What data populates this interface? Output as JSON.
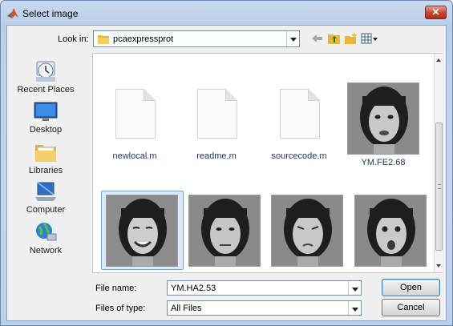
{
  "window": {
    "title": "Select image",
    "close_glyph": "✕"
  },
  "toolbar": {
    "look_in_label": "Look in:",
    "look_in_value": "pcaexpressprot",
    "icons": [
      "back-arrow-icon",
      "up-folder-icon",
      "new-folder-icon",
      "view-menu-icon"
    ]
  },
  "places": [
    {
      "label": "Recent Places",
      "icon": "recent-places-icon"
    },
    {
      "label": "Desktop",
      "icon": "desktop-icon"
    },
    {
      "label": "Libraries",
      "icon": "libraries-icon"
    },
    {
      "label": "Computer",
      "icon": "computer-icon"
    },
    {
      "label": "Network",
      "icon": "network-icon"
    }
  ],
  "files": [
    {
      "name": "newlocal.m",
      "kind": "document"
    },
    {
      "name": "readme.m",
      "kind": "document"
    },
    {
      "name": "sourcecode.m",
      "kind": "document"
    },
    {
      "name": "YM.FE2.68",
      "kind": "image"
    },
    {
      "name": "",
      "kind": "image",
      "selected": true
    },
    {
      "name": "",
      "kind": "image"
    },
    {
      "name": "",
      "kind": "image"
    },
    {
      "name": "",
      "kind": "image"
    }
  ],
  "bottom": {
    "file_name_label": "File name:",
    "file_name_value": "YM.HA2.53",
    "file_type_label": "Files of type:",
    "file_type_value": "All Files",
    "open_label": "Open",
    "cancel_label": "Cancel"
  },
  "colors": {
    "accent": "#3c7fb1",
    "selection": "#dcebfc",
    "link_text": "#1e395b"
  }
}
